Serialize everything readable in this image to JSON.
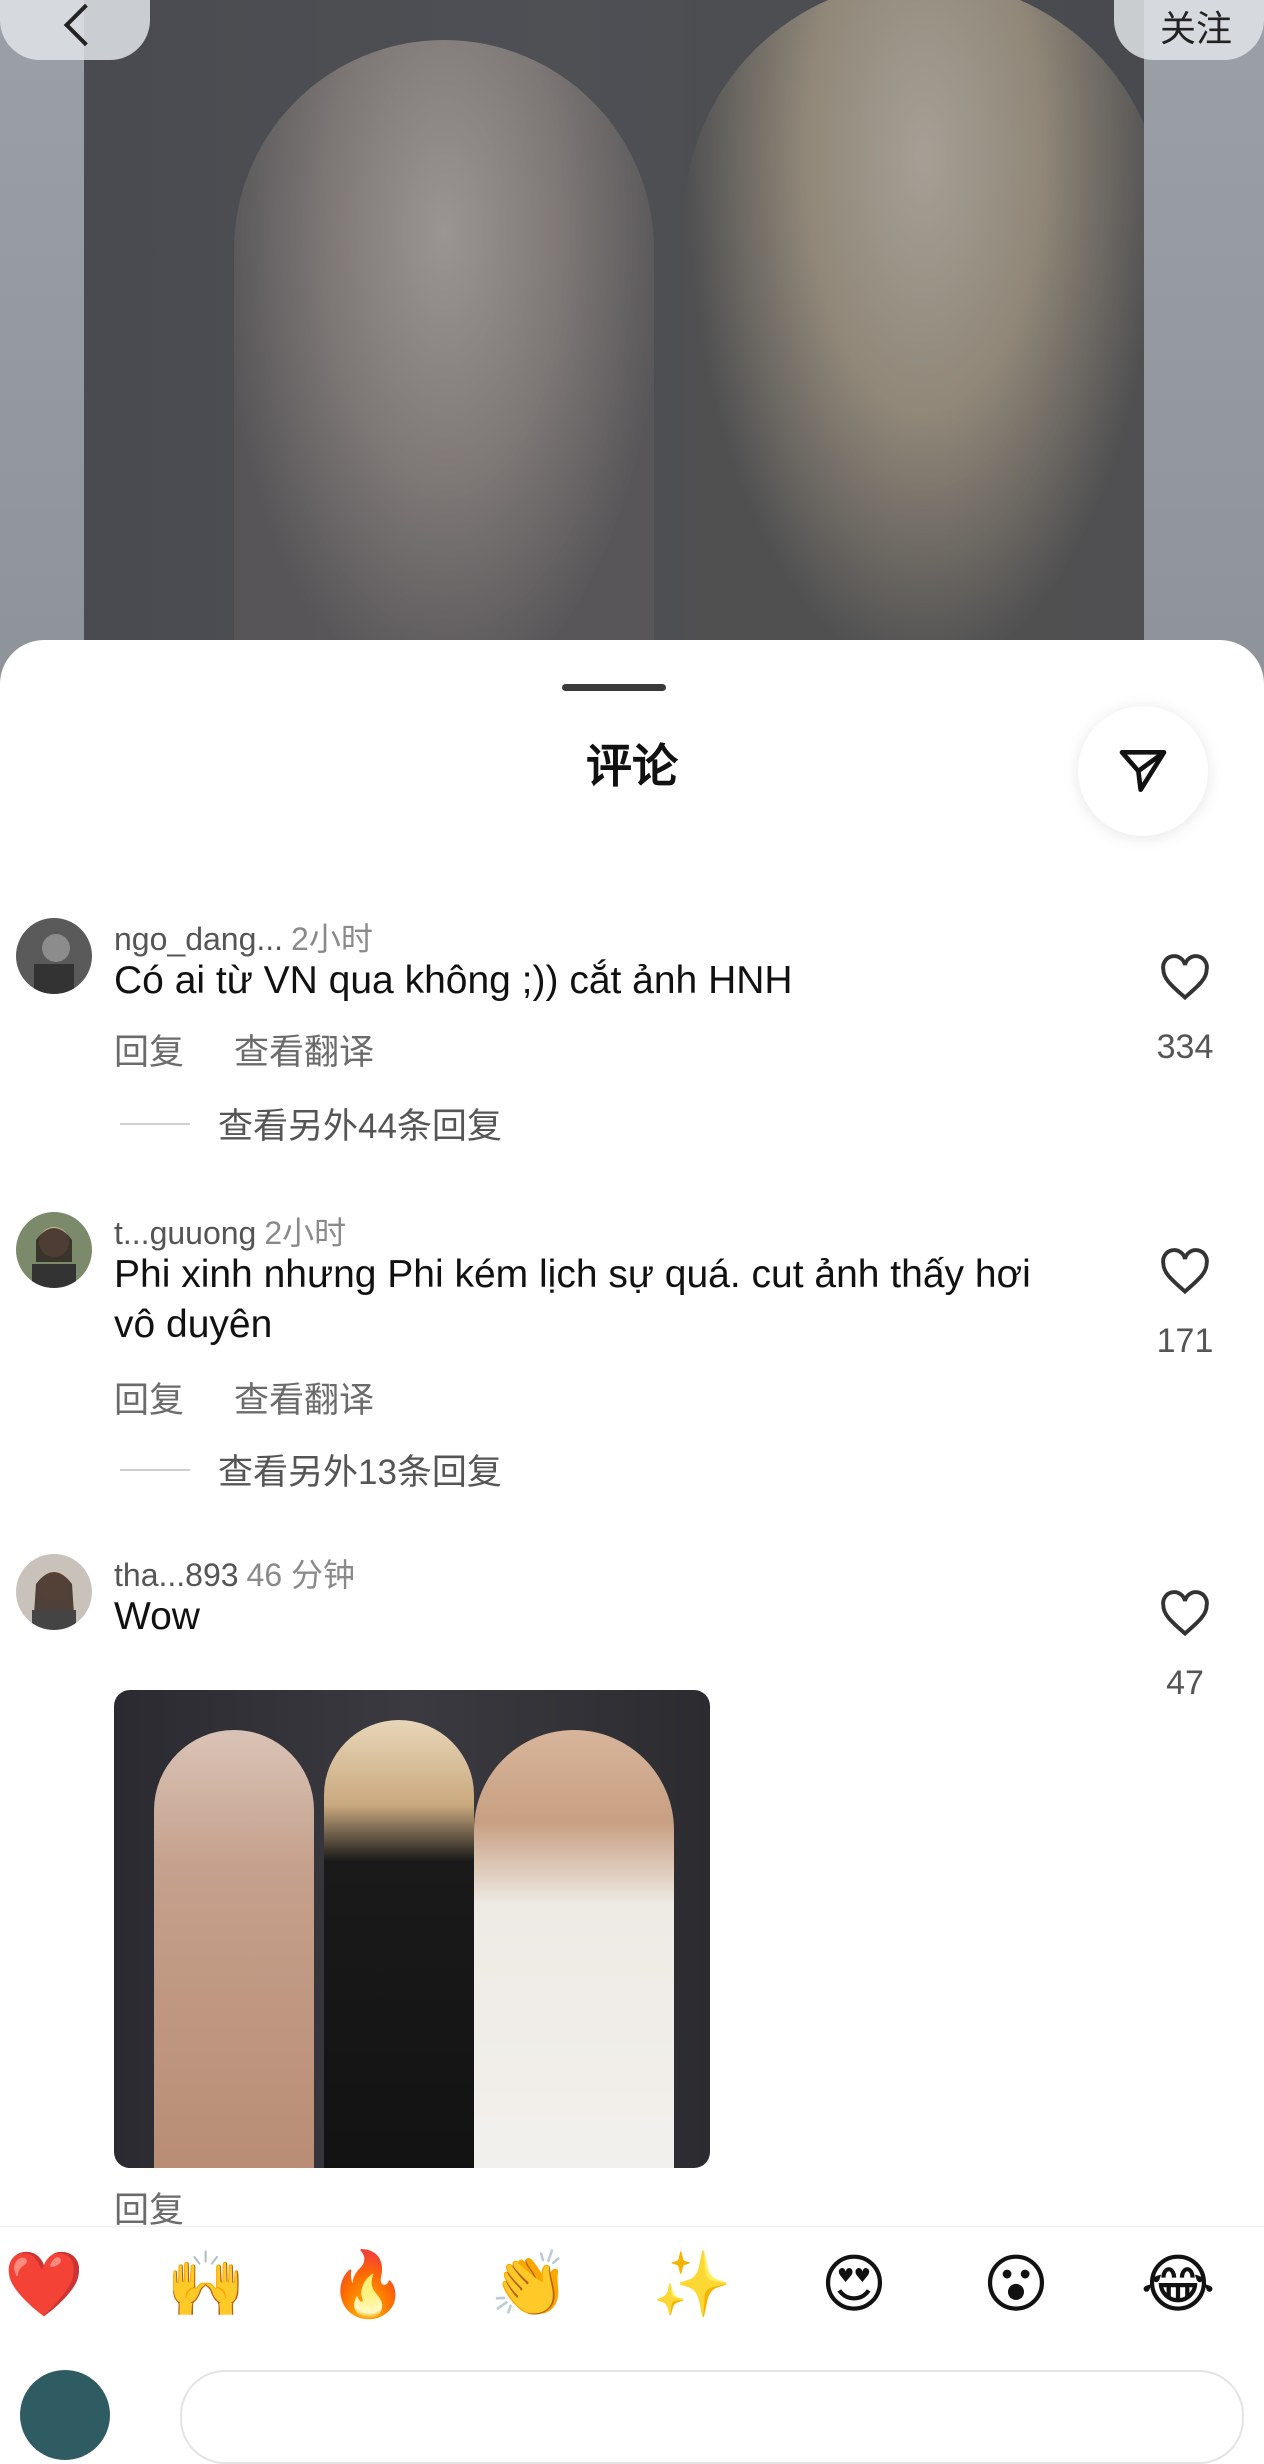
{
  "header": {
    "follow_label": "关注"
  },
  "sheet": {
    "title": "评论"
  },
  "comments": [
    {
      "username": "ngo_dang...",
      "time": "2小时",
      "text": "Có ai từ VN qua không ;)) cắt ảnh HNH",
      "reply_label": "回复",
      "translate_label": "查看翻译",
      "more_replies": "查看另外44条回复",
      "likes": "334"
    },
    {
      "username": "t...guuong",
      "time": "2小时",
      "text": "Phi xinh nhưng Phi kém lịch sự quá. cut ảnh thấy hơi vô duyên",
      "reply_label": "回复",
      "translate_label": "查看翻译",
      "more_replies": "查看另外13条回复",
      "likes": "171"
    },
    {
      "username": "tha...893",
      "time": "46 分钟",
      "text": "Wow",
      "reply_label": "回复",
      "likes": "47"
    }
  ],
  "emoji_bar": [
    "❤️",
    "🙌",
    "🔥",
    "👏",
    "✨",
    "😍",
    "😮",
    "😂"
  ],
  "colors": {
    "sheet_bg": "#ffffff",
    "text_primary": "#111111",
    "text_secondary": "#6b6b6b"
  }
}
